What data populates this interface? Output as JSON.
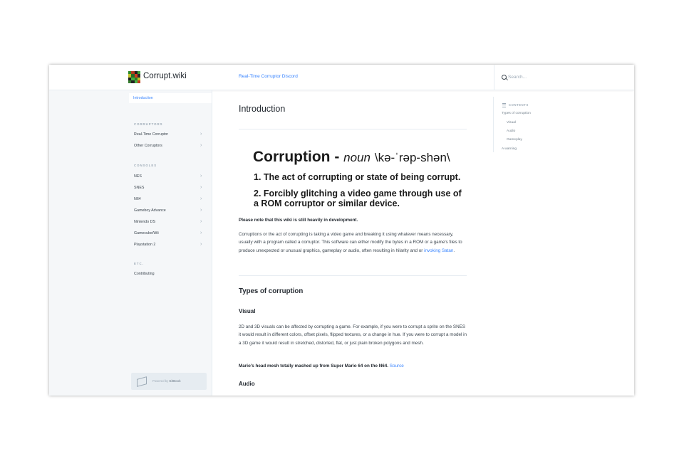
{
  "header": {
    "brand": "Corrupt.wiki",
    "discord_link": "Real-Time Corruptor Discord",
    "search_placeholder": "Search..."
  },
  "sidebar": {
    "active_item": "Introduction",
    "sections": [
      {
        "title": "CORRUPTORS",
        "items": [
          "Real-Time Corruptor",
          "Other Corruptors"
        ]
      },
      {
        "title": "CONSOLES",
        "items": [
          "NES",
          "SNES",
          "N64",
          "Gameboy Advance",
          "Nintendo DS",
          "Gamecube/Wii",
          "Playstation 2"
        ]
      },
      {
        "title": "ETC.",
        "items": [
          "Contributing"
        ]
      }
    ],
    "footer": {
      "prefix": "Powered by",
      "brand": "GitBook"
    }
  },
  "main": {
    "title": "Introduction",
    "definition": {
      "word": "Corruption",
      "dash": "-",
      "part_of_speech": "noun",
      "pronunciation": "\\kə-ˈrəp-shən\\",
      "def1": "1. The act of corrupting or state of being corrupt.",
      "def2": "2. Forcibly glitching a video game through use of a ROM corruptor or similar device."
    },
    "note": "Please note that this wiki is still heavily in development.",
    "intro_paragraph": "Corruptions or the act of corrupting is taking a video game and breaking it using whatever means necessary, usually with a program called a corruptor. This software can either modify the bytes in a ROM or a game's files to produce unexpected or unusual graphics, gameplay or audio, often resulting in hilarity and or ",
    "intro_link": "invoking Satan",
    "intro_end": ".",
    "types_heading": "Types of corruption",
    "visual_heading": "Visual",
    "visual_paragraph": "2D and 3D visuals can be affected by corrupting a game. For example, if you were to corrupt a sprite on the SNES it would result in different colors, offset pixels, flipped textures, or a change in hue. If you were to corrupt a model in a 3D game it would result in stretched, distorted, flat, or just plain broken polygons and mesh.",
    "caption": "Mario's head mesh totally mashed up from Super Mario 64 on the N64. ",
    "caption_link": "Source",
    "audio_heading": "Audio"
  },
  "toc": {
    "heading": "CONTENTS",
    "items": [
      "Types of corruption",
      "Visual",
      "Audio",
      "Gameplay",
      "A warning"
    ]
  },
  "colors": {
    "accent": "#3884ff",
    "sidebar_bg": "#f5f7f9",
    "text": "#3b454e"
  }
}
